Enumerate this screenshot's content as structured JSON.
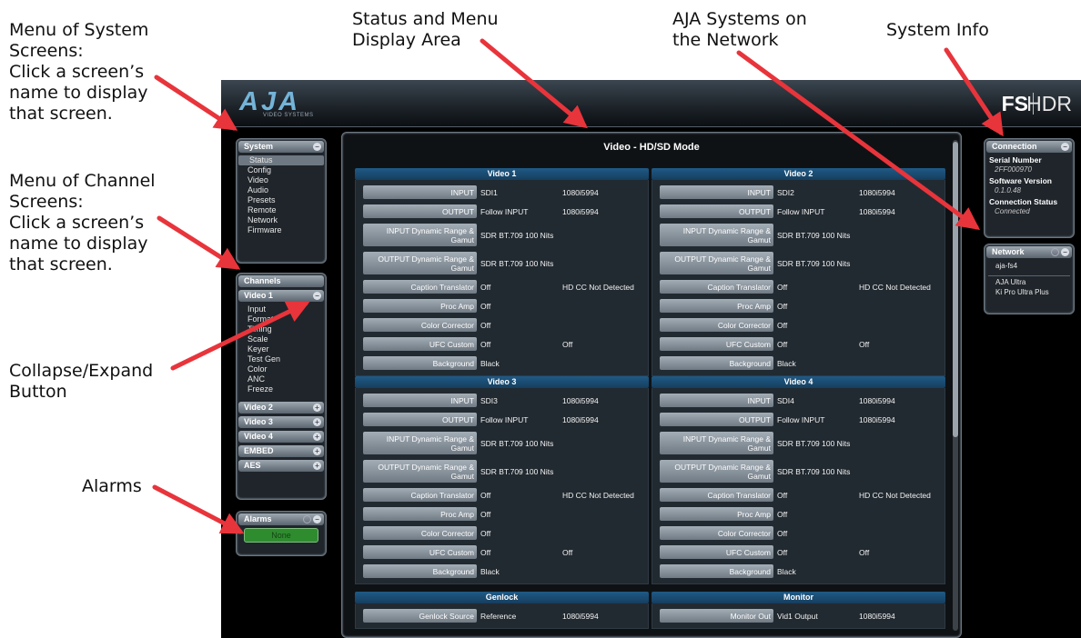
{
  "callouts": {
    "system_screens": "Menu of  System\nScreens:\nClick a screen’s\nname to display\nthat screen.",
    "status_area": "Status and Menu\nDisplay Area",
    "aja_network": "AJA Systems on\nthe Network",
    "system_info": "System Info",
    "channel_screens": "Menu of Channel\nScreens:\nClick a screen’s\nname to display\nthat screen.",
    "collapse_expand": "Collapse/Expand\nButton",
    "alarms": "Alarms"
  },
  "header": {
    "logo": "AJA",
    "logo_sub": "VIDEO SYSTEMS",
    "product_a": "FS",
    "product_b": "HDR"
  },
  "colors": {
    "arrow": "#e8343b",
    "section_header": "#1f5a86",
    "alarm_ok": "#2e8c2e"
  },
  "system_menu": {
    "title": "System",
    "items": [
      "Status",
      "Config",
      "Video",
      "Audio",
      "Presets",
      "Remote",
      "Network",
      "Firmware"
    ],
    "selected": "Status"
  },
  "channels": {
    "title": "Channels",
    "video1": {
      "title": "Video 1",
      "items": [
        "Input",
        "Format",
        "Timing",
        "Scale",
        "Keyer",
        "Test Gen",
        "Color",
        "ANC",
        "Freeze"
      ]
    },
    "collapsed": [
      "Video 2",
      "Video 3",
      "Video 4",
      "EMBED",
      "AES"
    ]
  },
  "alarms": {
    "title": "Alarms",
    "status": "None"
  },
  "main": {
    "title": "Video - HD/SD Mode",
    "labels": {
      "input": "INPUT",
      "output": "OUTPUT",
      "input_dr": "INPUT Dynamic Range & Gamut",
      "output_dr": "OUTPUT Dynamic Range & Gamut",
      "caption": "Caption Translator",
      "procamp": "Proc Amp",
      "colorcorr": "Color Corrector",
      "ufc": "UFC Custom",
      "background": "Background"
    },
    "video": [
      {
        "title": "Video 1",
        "input": "SDI1",
        "input_fmt": "1080i5994",
        "output": "Follow INPUT",
        "output_fmt": "1080i5994",
        "input_dr": "SDR BT.709 100 Nits",
        "output_dr": "SDR BT.709 100 Nits",
        "caption": "Off",
        "caption_status": "HD CC Not Detected",
        "procamp": "Off",
        "colorcorr": "Off",
        "ufc": "Off",
        "ufc2": "Off",
        "background": "Black"
      },
      {
        "title": "Video 2",
        "input": "SDI2",
        "input_fmt": "1080i5994",
        "output": "Follow INPUT",
        "output_fmt": "1080i5994",
        "input_dr": "SDR BT.709 100 Nits",
        "output_dr": "SDR BT.709 100 Nits",
        "caption": "Off",
        "caption_status": "HD CC Not Detected",
        "procamp": "Off",
        "colorcorr": "Off",
        "ufc": "Off",
        "ufc2": "Off",
        "background": "Black"
      },
      {
        "title": "Video 3",
        "input": "SDI3",
        "input_fmt": "1080i5994",
        "output": "Follow INPUT",
        "output_fmt": "1080i5994",
        "input_dr": "SDR BT.709 100 Nits",
        "output_dr": "SDR BT.709 100 Nits",
        "caption": "Off",
        "caption_status": "HD CC Not Detected",
        "procamp": "Off",
        "colorcorr": "Off",
        "ufc": "Off",
        "ufc2": "Off",
        "background": "Black"
      },
      {
        "title": "Video 4",
        "input": "SDI4",
        "input_fmt": "1080i5994",
        "output": "Follow INPUT",
        "output_fmt": "1080i5994",
        "input_dr": "SDR BT.709 100 Nits",
        "output_dr": "SDR BT.709 100 Nits",
        "caption": "Off",
        "caption_status": "HD CC Not Detected",
        "procamp": "Off",
        "colorcorr": "Off",
        "ufc": "Off",
        "ufc2": "Off",
        "background": "Black"
      }
    ],
    "genlock": {
      "title": "Genlock",
      "label": "Genlock Source",
      "value": "Reference",
      "fmt": "1080i5994"
    },
    "monitor": {
      "title": "Monitor",
      "label": "Monitor Out",
      "value": "Vid1 Output",
      "fmt": "1080i5994"
    }
  },
  "connection": {
    "title": "Connection",
    "serial_label": "Serial Number",
    "serial": "2FF000970",
    "sw_label": "Software Version",
    "sw": "0.1.0.48",
    "status_label": "Connection Status",
    "status": "Connected"
  },
  "network": {
    "title": "Network",
    "self": "aja-fs4",
    "systems": [
      "AJA Ultra",
      "Ki Pro Ultra Plus"
    ]
  }
}
